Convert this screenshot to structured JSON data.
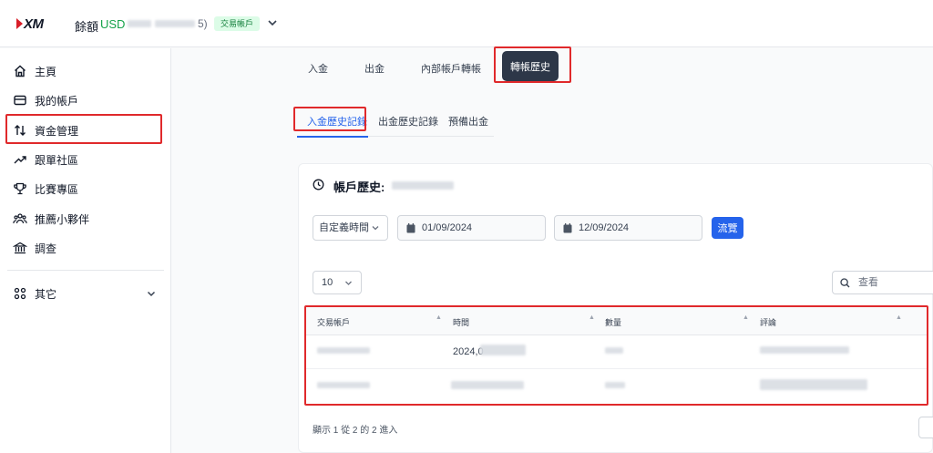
{
  "header": {
    "logo_text": "XM",
    "balance_label": "餘額",
    "currency": "USD",
    "balance_tail": "5)",
    "account_badge": "交易帳戶"
  },
  "sidebar": {
    "items": [
      {
        "label": "主頁",
        "icon": "home-icon"
      },
      {
        "label": "我的帳戶",
        "icon": "wallet-icon"
      },
      {
        "label": "資金管理",
        "icon": "transfer-arrows-icon"
      },
      {
        "label": "跟單社區",
        "icon": "trend-up-icon"
      },
      {
        "label": "比賽專區",
        "icon": "trophy-icon"
      },
      {
        "label": "推薦小夥伴",
        "icon": "people-icon"
      },
      {
        "label": "調查",
        "icon": "institution-icon"
      }
    ],
    "other_label": "其它"
  },
  "tabs": [
    {
      "label": "入金"
    },
    {
      "label": "出金"
    },
    {
      "label": "內部帳戶轉帳"
    },
    {
      "label": "轉帳歷史"
    }
  ],
  "subtabs": [
    {
      "label": "入金歷史記錄"
    },
    {
      "label": "出金歷史記錄"
    },
    {
      "label": "預備出金"
    }
  ],
  "card": {
    "title": "帳戶歷史:",
    "range_select": "自定義時間",
    "date_from": "01/09/2024",
    "date_to": "12/09/2024",
    "browse_label": "流覽",
    "page_size": "10",
    "search_placeholder": "查看"
  },
  "table": {
    "columns": [
      "交易帳戶",
      "時間",
      "數量",
      "評論"
    ],
    "rows": [
      {
        "time": "2024,0"
      },
      {
        "time": ""
      }
    ]
  },
  "footer": {
    "summary": "顯示 1 從 2 的 2 進入"
  },
  "colors": {
    "accent": "#2563eb",
    "highlight": "#e0292b",
    "active_tab_bg": "#2d3748",
    "badge_bg": "#dcfce7",
    "badge_text": "#15803d"
  }
}
